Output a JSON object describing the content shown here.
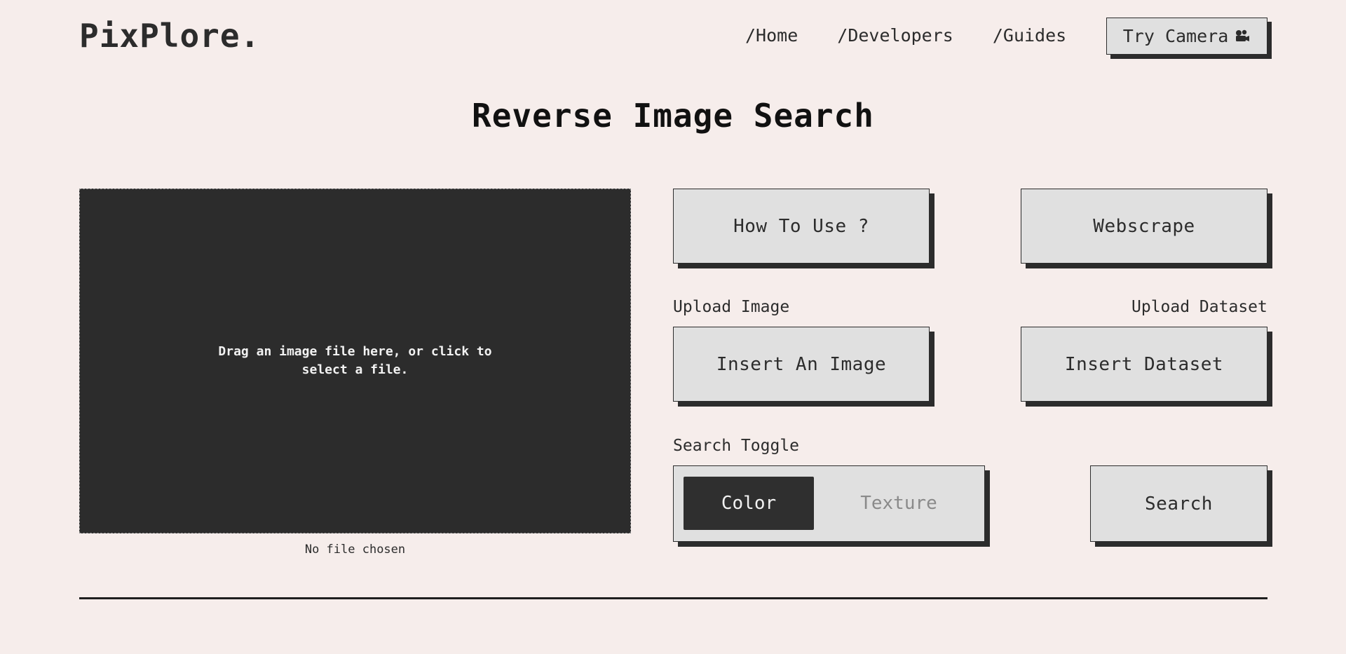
{
  "header": {
    "logo": "PixPlore.",
    "nav": [
      {
        "label": "/Home"
      },
      {
        "label": "/Developers"
      },
      {
        "label": "/Guides"
      }
    ],
    "try_camera_label": "Try Camera",
    "try_camera_icon": "camera-icon"
  },
  "main": {
    "title": "Reverse Image Search",
    "dropzone_text": "Drag an image file here, or click to select a file.",
    "file_status": "No file chosen",
    "how_to_use_label": "How To Use ?",
    "webscrape_label": "Webscrape",
    "upload_image_label": "Upload Image",
    "upload_dataset_label": "Upload Dataset",
    "insert_image_label": "Insert An Image",
    "insert_dataset_label": "Insert Dataset",
    "search_toggle_label": "Search Toggle",
    "toggle_options": [
      {
        "label": "Color",
        "active": true
      },
      {
        "label": "Texture",
        "active": false
      }
    ],
    "search_label": "Search"
  },
  "colors": {
    "background": "#f6edeb",
    "dark": "#2c2c2c",
    "button_bg": "#e0e0e0"
  }
}
